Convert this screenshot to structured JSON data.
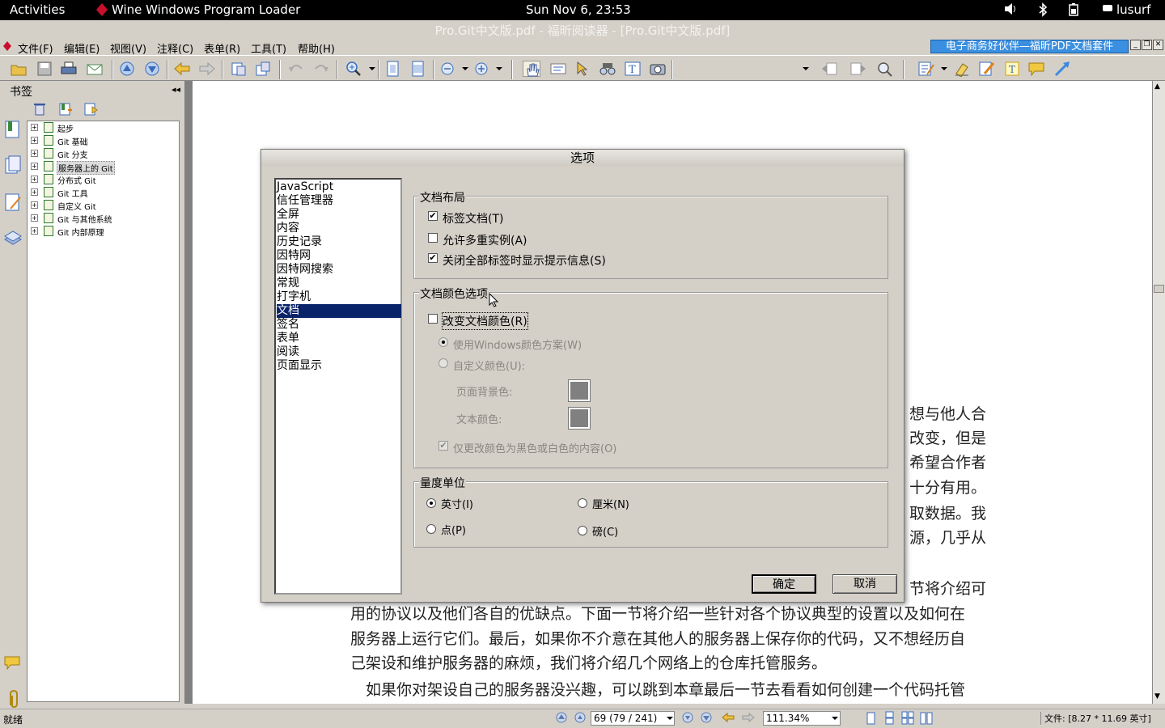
{
  "topbar": {
    "activities": "Activities",
    "app": "Wine Windows Program Loader",
    "clock": "Sun Nov  6, 23:53",
    "user": "lusurf"
  },
  "window": {
    "title": "Pro.Git中文版.pdf - 福昕阅读器 - [Pro.Git中文版.pdf]",
    "promo": "电子商务好伙伴—福昕PDF文档套件"
  },
  "menu": [
    "文件(F)",
    "编辑(E)",
    "视图(V)",
    "注释(C)",
    "表单(R)",
    "工具(T)",
    "帮助(H)"
  ],
  "bookmarks": {
    "header": "书签",
    "items": [
      "起步",
      "Git 基础",
      "Git 分支",
      "服务器上的 Git",
      "分布式 Git",
      "Git 工具",
      "自定义 Git",
      "Git 与其他系统",
      "Git 内部原理"
    ],
    "selected": "服务器上的 Git"
  },
  "document": {
    "lines_right": [
      "想与他人合",
      "改变，但是",
      "希望合作者",
      "十分有用。",
      "取数据。我",
      "源，几乎从"
    ],
    "line_partial": "节将介绍可",
    "lines_full": [
      "用的协议以及他们各自的优缺点。下面一节将介绍一些针对各个协议典型的设置以及如何在",
      "服务器上运行它们。最后，如果你不介意在其他人的服务器上保存你的代码，又不想经历自",
      "己架设和维护服务器的麻烦，我们将介绍几个网络上的仓库托管服务。",
      "如果你对架设自己的服务器没兴趣，可以跳到本章最后一节去看看如何创建一个代码托管"
    ]
  },
  "dialog": {
    "title": "选项",
    "categories": [
      "JavaScript",
      "信任管理器",
      "全屏",
      "内容",
      "历史记录",
      "因特网",
      "因特网搜索",
      "常规",
      "打字机",
      "文档",
      "签名",
      "表单",
      "阅读",
      "页面显示"
    ],
    "selected_category": "文档",
    "layout_group": {
      "title": "文档布局",
      "tabbed": {
        "label": "标签文档(T)",
        "checked": true
      },
      "multi_instance": {
        "label": "允许多重实例(A)",
        "checked": false
      },
      "close_prompt": {
        "label": "关闭全部标签时显示提示信息(S)",
        "checked": true
      }
    },
    "color_group": {
      "title": "文档颜色选项",
      "change_color": {
        "label": "改变文档颜色(R)",
        "checked": false
      },
      "use_windows": "使用Windows颜色方案(W)",
      "custom": "自定义颜色(U):",
      "bg_label": "页面背景色:",
      "text_label": "文本颜色:",
      "only_bw": {
        "label": "仅更改颜色为黑色或白色的内容(O)",
        "checked": true
      }
    },
    "unit_group": {
      "title": "量度单位",
      "inch": "英寸(I)",
      "cm": "厘米(N)",
      "point": "点(P)",
      "pica": "磅(C)",
      "selected": "inch"
    },
    "ok": "确定",
    "cancel": "取消"
  },
  "status": {
    "ready": "就绪",
    "page": "69 (79 / 241)",
    "zoom": "111.34%",
    "filesize": "文件: [8.27 * 11.69 英寸]"
  },
  "colors": {
    "selection": "#0a246a",
    "promo": "#3a8fe0",
    "chrome": "#d4d0c8"
  }
}
